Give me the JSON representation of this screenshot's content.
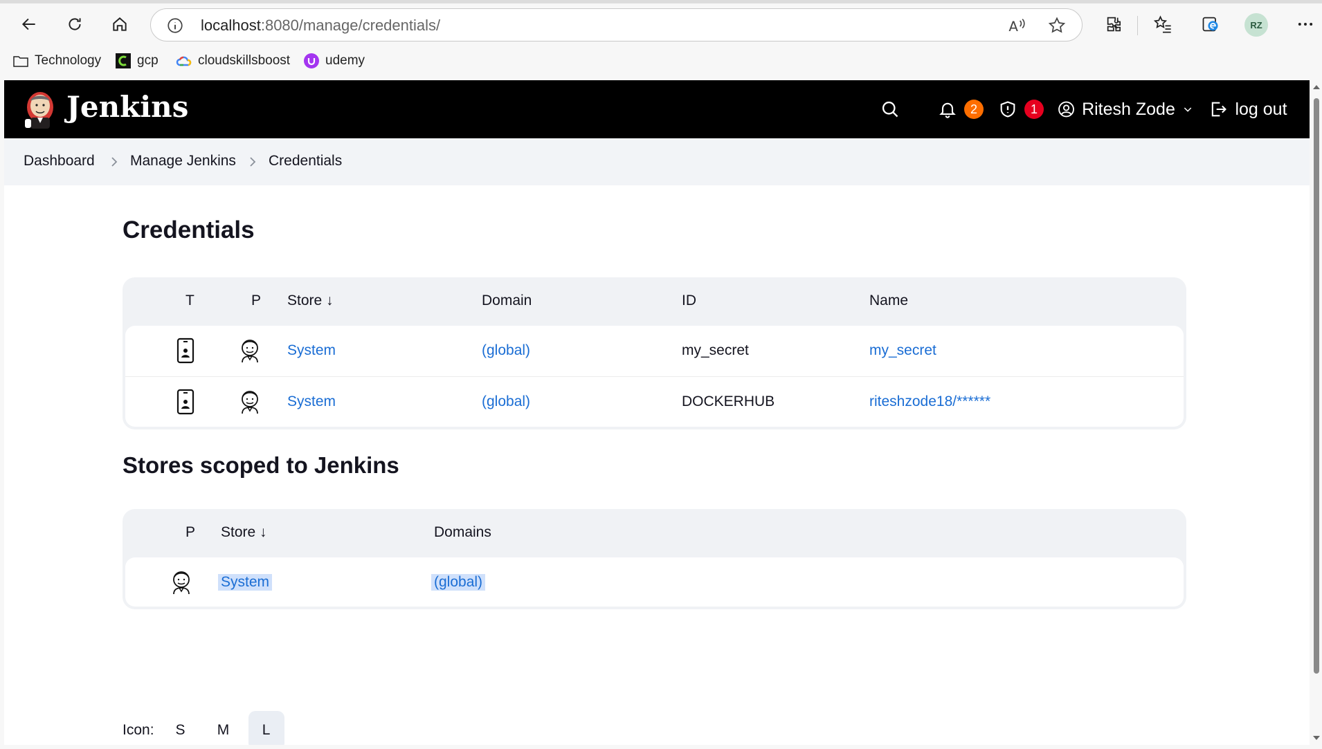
{
  "browser": {
    "url_host": "localhost",
    "url_rest": ":8080/manage/credentials/",
    "profile_initials": "RZ",
    "bookmarks": [
      {
        "label": "Technology",
        "icon": "folder-icon"
      },
      {
        "label": "gcp",
        "icon": "gcp-icon"
      },
      {
        "label": "cloudskillsboost",
        "icon": "google-cloud-icon"
      },
      {
        "label": "udemy",
        "icon": "udemy-icon"
      }
    ]
  },
  "header": {
    "title": "Jenkins",
    "notifications_count": "2",
    "security_count": "1",
    "user_name": "Ritesh Zode",
    "logout_label": "log out",
    "colors": {
      "bar": "#000000",
      "notify_badge": "#fe6e00",
      "security_badge": "#e6001f"
    }
  },
  "breadcrumbs": [
    "Dashboard",
    "Manage Jenkins",
    "Credentials"
  ],
  "credentials": {
    "heading": "Credentials",
    "columns": {
      "t": "T",
      "p": "P",
      "store": "Store ↓",
      "domain": "Domain",
      "id": "ID",
      "name": "Name"
    },
    "rows": [
      {
        "store": "System",
        "domain": "(global)",
        "id": "my_secret",
        "name": "my_secret"
      },
      {
        "store": "System",
        "domain": "(global)",
        "id": "DOCKERHUB",
        "name": "riteshzode18/******"
      }
    ]
  },
  "stores": {
    "heading": "Stores scoped to Jenkins",
    "columns": {
      "p": "P",
      "store": "Store ↓",
      "domains": "Domains"
    },
    "rows": [
      {
        "store": "System",
        "domains": "(global)"
      }
    ]
  },
  "icon_size": {
    "label": "Icon:",
    "options": [
      "S",
      "M",
      "L"
    ],
    "selected": "L"
  },
  "link_color": "#1a6dd4"
}
